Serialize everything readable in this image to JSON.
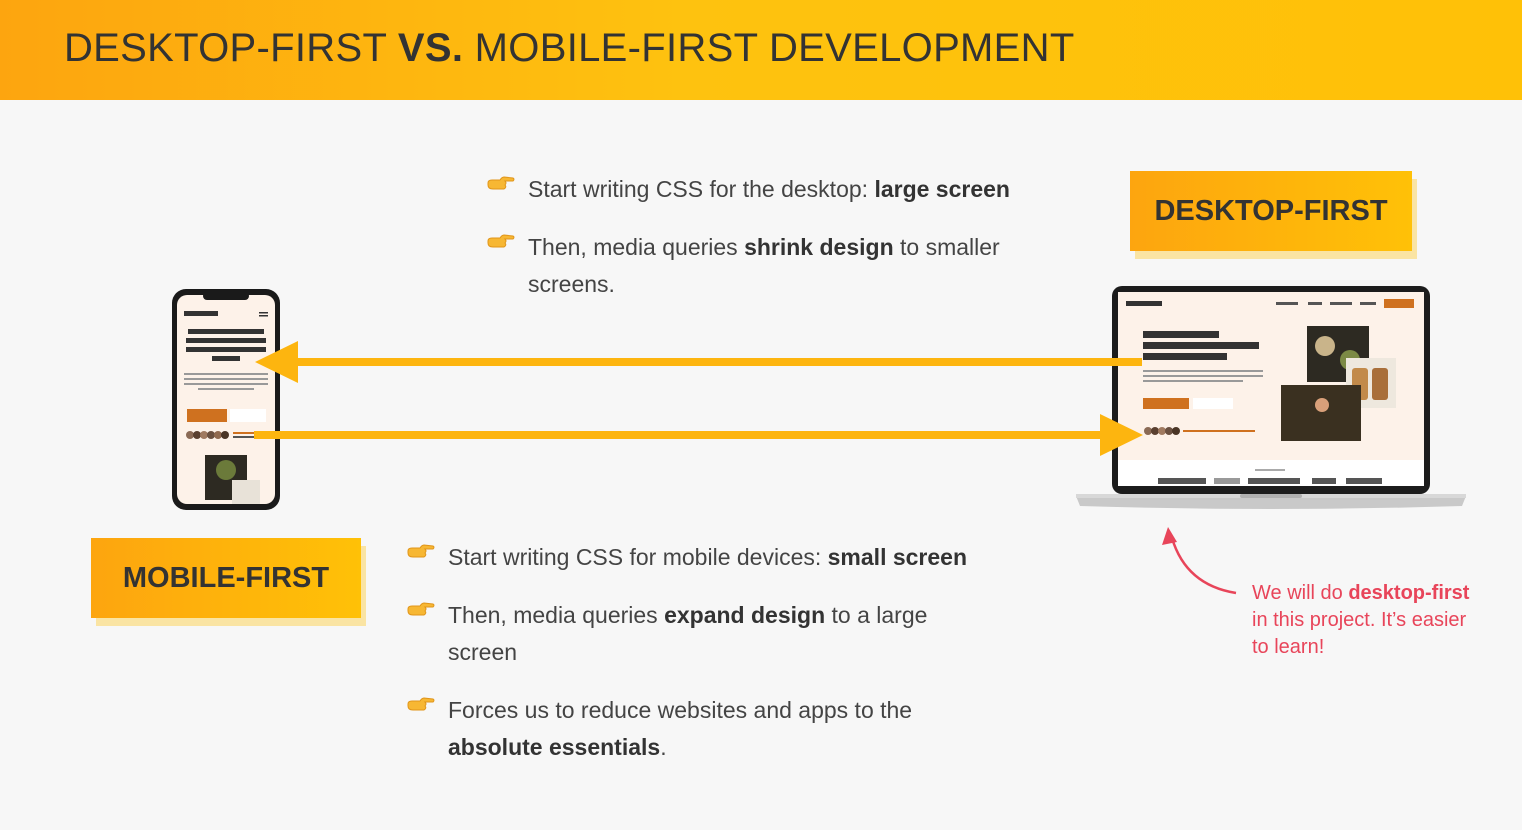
{
  "header": {
    "title_part1": "DESKTOP-FIRST ",
    "title_vs": "VS.",
    "title_part2": " MOBILE-FIRST DEVELOPMENT"
  },
  "desktop_first": {
    "tag": "DESKTOP-FIRST",
    "bullets": [
      {
        "pre": "Start writing CSS for the desktop: ",
        "bold": "large screen",
        "post": ""
      },
      {
        "pre": "Then, media queries ",
        "bold": "shrink design",
        "post": " to smaller screens."
      }
    ]
  },
  "mobile_first": {
    "tag": "MOBILE-FIRST",
    "bullets": [
      {
        "pre": "Start writing CSS for mobile devices: ",
        "bold": "small screen",
        "post": ""
      },
      {
        "pre": "Then, media queries ",
        "bold": "expand design",
        "post": " to a large screen"
      },
      {
        "pre": "Forces us to reduce websites and apps to the ",
        "bold": "absolute essentials",
        "post": "."
      }
    ]
  },
  "note": {
    "pre": "We will do ",
    "bold": "desktop-first",
    "post": " in this project. It’s easier to learn!"
  },
  "icons": {
    "bullet": "pointing-hand-icon",
    "phone": "smartphone-icon",
    "laptop": "laptop-icon"
  },
  "colors": {
    "accent": "#ffc107",
    "accent_dark": "#fda50f",
    "arrow": "#fdb50f",
    "note": "#e8455a",
    "text": "#333333"
  }
}
